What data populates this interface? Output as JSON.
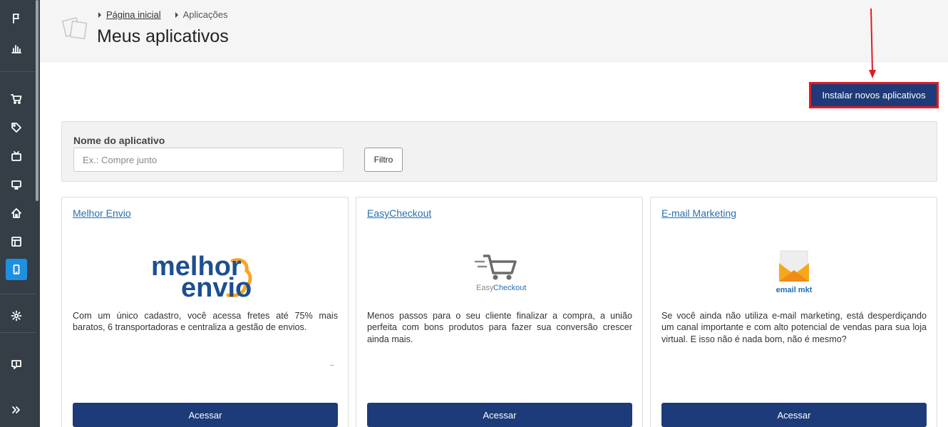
{
  "breadcrumb": {
    "home": "Página inicial",
    "current": "Aplicações"
  },
  "page": {
    "title": "Meus aplicativos"
  },
  "actions": {
    "install_label": "Instalar novos aplicativos"
  },
  "filter": {
    "label": "Nome do aplicativo",
    "placeholder": "Ex.: Compre junto",
    "value": "",
    "button_label": "Filtro"
  },
  "apps": [
    {
      "name": "Melhor Envio",
      "logo_line1": "melhor",
      "logo_line2": "envio",
      "description": "Com um único cadastro, você acessa fretes até 75% mais baratos, 6 transportadoras e centraliza a gestão de envios.",
      "button_label": "Acessar"
    },
    {
      "name": "EasyCheckout",
      "logo_text_a": "Easy",
      "logo_text_b": "Checkout",
      "description": "Menos passos para o seu cliente finalizar a compra, a união perfeita com bons produtos para fazer sua conversão crescer ainda mais.",
      "button_label": "Acessar"
    },
    {
      "name": "E-mail Marketing",
      "logo_text": "email mkt",
      "description": "Se você ainda não utiliza e-mail marketing, está desperdiçando um canal importante e com alto potencial de vendas para sua loja virtual. E isso não é nada bom, não é mesmo?",
      "button_label": "Acessar"
    }
  ],
  "sidebar": {
    "items": [
      "flag-icon",
      "chart-icon",
      "cart-icon",
      "tag-icon",
      "tv-icon",
      "monitor-icon",
      "home-icon",
      "layout-icon",
      "mobile-icon",
      "gear-icon",
      "help-icon",
      "expand-icon"
    ],
    "active": "mobile-icon"
  },
  "colors": {
    "primary": "#1d3b78",
    "sidebar": "#353d47",
    "active": "#1f8fe0",
    "highlight": "#e01b22",
    "link": "#2a6fb0"
  }
}
